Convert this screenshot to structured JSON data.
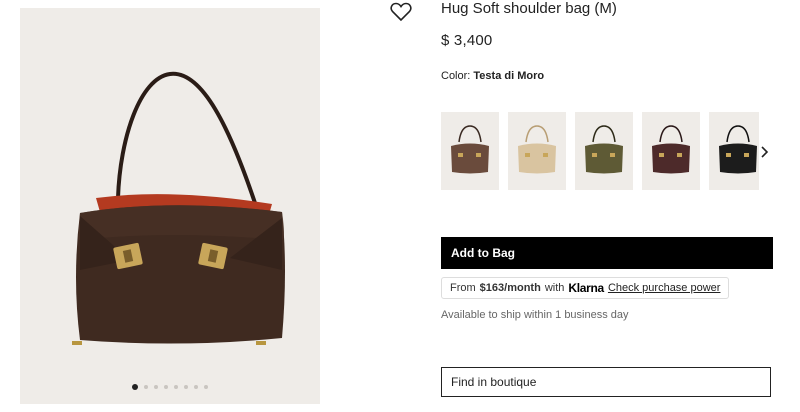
{
  "product": {
    "title": "Hug Soft shoulder bag (M)",
    "price": "$ 3,400",
    "color_label": "Color:",
    "color_value": "Testa di Moro"
  },
  "gallery": {
    "image_name": "brown-suede-shoulder-bag",
    "slides": 8,
    "active_slide": 1
  },
  "swatches": [
    {
      "name": "brown-swatch",
      "color": "#6a4b3c"
    },
    {
      "name": "beige-swatch",
      "color": "#d9c4a0"
    },
    {
      "name": "olive-swatch",
      "color": "#5e5a35"
    },
    {
      "name": "burgundy-swatch",
      "color": "#4d2a2a"
    },
    {
      "name": "black-swatch",
      "color": "#1c1c1c"
    }
  ],
  "actions": {
    "add_to_bag": "Add to Bag",
    "find_in_boutique": "Find in boutique"
  },
  "klarna": {
    "prefix": "From",
    "amount": "$163/month",
    "with": "with",
    "brand": "Klarna",
    "link": "Check purchase power"
  },
  "shipping": "Available to ship within 1 business day",
  "icons": {
    "wishlist": "heart-icon",
    "next": "chevron-right-icon"
  }
}
